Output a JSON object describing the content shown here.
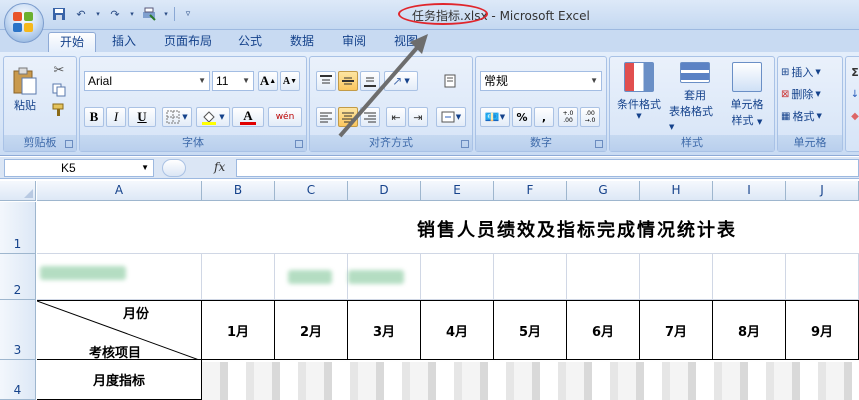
{
  "window": {
    "file_name": "任务指标.xlsx",
    "app_name": " - Microsoft Excel"
  },
  "tabs": [
    "开始",
    "插入",
    "页面布局",
    "公式",
    "数据",
    "审阅",
    "视图"
  ],
  "ribbon": {
    "clipboard": {
      "label": "剪贴板",
      "paste": "粘贴"
    },
    "font": {
      "label": "字体",
      "family": "Arial",
      "size": "11",
      "bold": "B",
      "italic": "I",
      "underline": "U",
      "grow": "A",
      "shrink": "A",
      "font_color": "A",
      "phonetic": "wén"
    },
    "alignment": {
      "label": "对齐方式"
    },
    "number": {
      "label": "数字",
      "format": "常规",
      "percent": "%",
      "comma": ",",
      "inc_decimal": "+.0 .00",
      "dec_decimal": ".00 →.0"
    },
    "styles": {
      "label": "样式",
      "conditional": "条件格式",
      "table_line1": "套用",
      "table_line2": "表格格式",
      "cell_line1": "单元格",
      "cell_line2": "样式"
    },
    "cells": {
      "label": "单元格",
      "insert": "插入",
      "delete": "删除",
      "format": "格式"
    },
    "extra": {
      "sigma": "Σ"
    }
  },
  "formula_bar": {
    "name_box": "K5",
    "fx": "fx",
    "formula": ""
  },
  "grid": {
    "columns": [
      "A",
      "B",
      "C",
      "D",
      "E",
      "F",
      "G",
      "H",
      "I",
      "J"
    ],
    "rows": [
      "1",
      "2",
      "3",
      "4"
    ],
    "title": "销售人员绩效及指标完成情况统计表",
    "header_top": "月份",
    "header_bottom": "考核项目",
    "months": [
      "1月",
      "2月",
      "3月",
      "4月",
      "5月",
      "6月",
      "7月",
      "8月",
      "9月"
    ],
    "row4_label": "月度指标"
  }
}
